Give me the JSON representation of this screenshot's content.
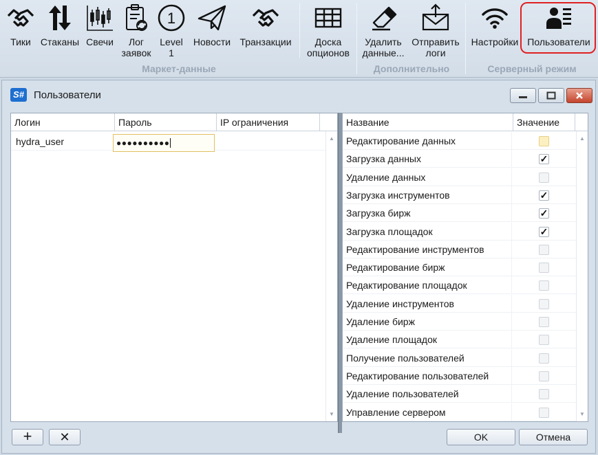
{
  "ribbon": {
    "buttons": [
      {
        "label": "Тики",
        "icon": "handshake-icon"
      },
      {
        "label": "Стаканы",
        "icon": "up-down-arrows-icon"
      },
      {
        "label": "Свечи",
        "icon": "candlestick-chart-icon"
      },
      {
        "label": "Лог\nзаявок",
        "icon": "clipboard-refresh-icon"
      },
      {
        "label": "Level\n1",
        "icon": "circled-one-icon"
      },
      {
        "label": "Новости",
        "icon": "paper-plane-icon"
      },
      {
        "label": "Транзакции",
        "icon": "handshake-icon"
      },
      {
        "label": "Доска\nопционов",
        "icon": "table-grid-icon"
      },
      {
        "label": "Удалить\nданные...",
        "icon": "eraser-icon"
      },
      {
        "label": "Отправить\nлоги",
        "icon": "envelope-upload-icon"
      },
      {
        "label": "Настройки",
        "icon": "wifi-icon"
      },
      {
        "label": "Пользователи",
        "icon": "user-list-icon"
      }
    ],
    "groups": [
      "Маркет-данные",
      "Дополнительно",
      "Серверный режим"
    ]
  },
  "window": {
    "logo": "S#",
    "title": "Пользователи"
  },
  "users_grid": {
    "columns": [
      "Логин",
      "Пароль",
      "IP ограничения"
    ],
    "rows": [
      {
        "login": "hydra_user",
        "password": "●●●●●●●●●●",
        "ip": ""
      }
    ]
  },
  "perm_grid": {
    "columns": [
      "Название",
      "Значение"
    ],
    "rows": [
      {
        "name": "Редактирование данных",
        "checked": false,
        "focus": true
      },
      {
        "name": "Загрузка данных",
        "checked": true
      },
      {
        "name": "Удаление данных",
        "checked": false
      },
      {
        "name": "Загрузка инструментов",
        "checked": true
      },
      {
        "name": "Загрузка бирж",
        "checked": true
      },
      {
        "name": "Загрузка площадок",
        "checked": true
      },
      {
        "name": "Редактирование инструментов",
        "checked": false
      },
      {
        "name": "Редактирование бирж",
        "checked": false
      },
      {
        "name": "Редактирование площадок",
        "checked": false
      },
      {
        "name": "Удаление инструментов",
        "checked": false
      },
      {
        "name": "Удаление бирж",
        "checked": false
      },
      {
        "name": "Удаление площадок",
        "checked": false
      },
      {
        "name": "Получение пользователей",
        "checked": false
      },
      {
        "name": "Редактирование пользователей",
        "checked": false
      },
      {
        "name": "Удаление пользователей",
        "checked": false
      },
      {
        "name": "Управление сервером",
        "checked": false
      }
    ]
  },
  "footer": {
    "add_symbol": "+",
    "remove_symbol": "✕",
    "ok": "OK",
    "cancel": "Отмена"
  }
}
